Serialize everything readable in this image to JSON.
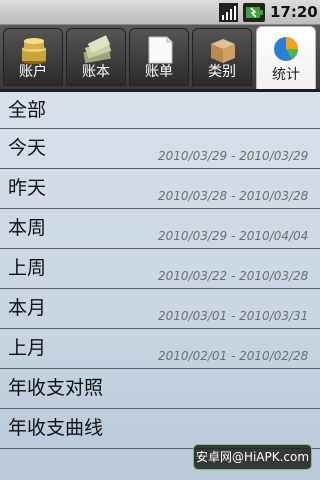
{
  "status_bar": {
    "signal_icon": "signal-full-icon",
    "battery_icon": "battery-charging-icon",
    "time": "17:20"
  },
  "tabs": [
    {
      "label": "账户",
      "icon": "coins-icon",
      "active": false
    },
    {
      "label": "账本",
      "icon": "money-stack-icon",
      "active": false
    },
    {
      "label": "账单",
      "icon": "document-icon",
      "active": false
    },
    {
      "label": "类别",
      "icon": "box-icon",
      "active": false
    },
    {
      "label": "统计",
      "icon": "pie-chart-icon",
      "active": true
    }
  ],
  "list": [
    {
      "label": "全部",
      "range": ""
    },
    {
      "label": "今天",
      "range": "2010/03/29 - 2010/03/29"
    },
    {
      "label": "昨天",
      "range": "2010/03/28 - 2010/03/28"
    },
    {
      "label": "本周",
      "range": "2010/03/29 - 2010/04/04"
    },
    {
      "label": "上周",
      "range": "2010/03/22 - 2010/03/28"
    },
    {
      "label": "本月",
      "range": "2010/03/01 - 2010/03/31"
    },
    {
      "label": "上月",
      "range": "2010/02/01 - 2010/02/28"
    },
    {
      "label": "年收支对照",
      "range": ""
    },
    {
      "label": "年收支曲线",
      "range": ""
    }
  ],
  "watermark": "安卓网@HiAPK.com",
  "colors": {
    "tabbar_dark": "#3a3a3a",
    "active_tab": "#ffffff",
    "list_bg": "#d3dde8",
    "range_text": "#6e6e6e",
    "watermark_border": "#7ec27e"
  }
}
